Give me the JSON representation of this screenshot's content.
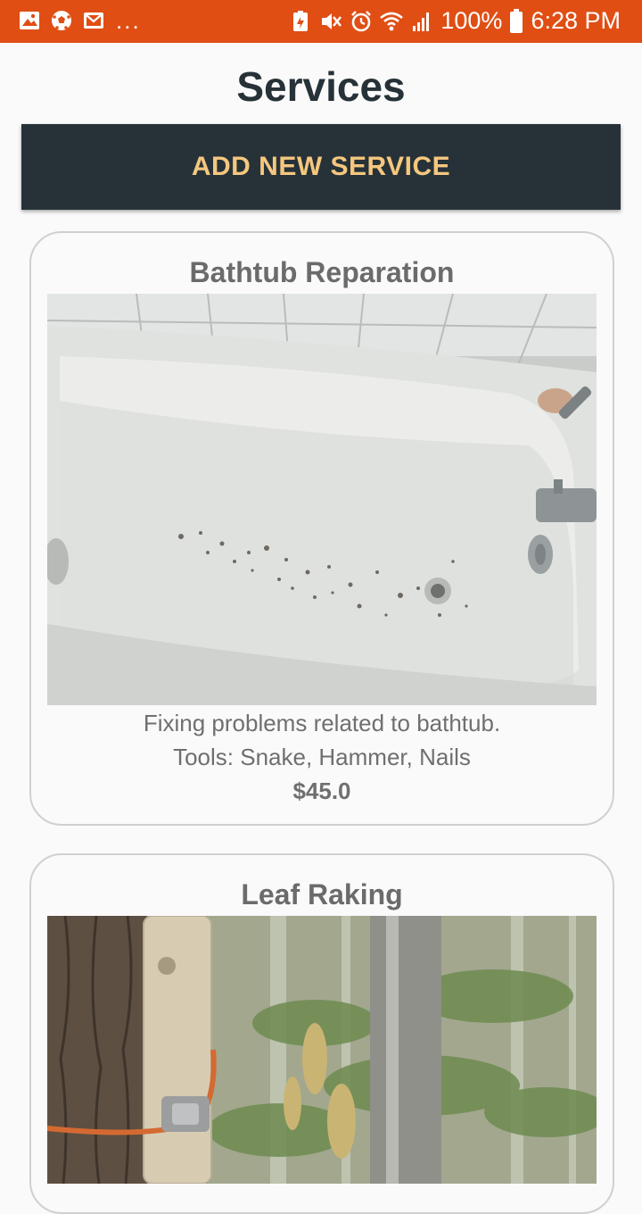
{
  "status_bar": {
    "battery": "100%",
    "time": "6:28 PM",
    "overflow": "...",
    "icons": [
      "image-icon",
      "soccer-ball-icon",
      "mail-icon",
      "battery-saver-icon",
      "mute-icon",
      "alarm-icon",
      "wifi-icon",
      "signal-icon",
      "battery-icon"
    ]
  },
  "page": {
    "title": "Services",
    "add_button": "ADD NEW SERVICE"
  },
  "services": [
    {
      "title": "Bathtub Reparation",
      "description": "Fixing problems related to bathtub.",
      "tools": "Tools: Snake, Hammer, Nails",
      "price": "$45.0"
    },
    {
      "title": "Leaf Raking"
    }
  ],
  "colors": {
    "status_bar": "#e04e14",
    "button_bg": "#263238",
    "button_text": "#f5c77e",
    "title": "#263238"
  }
}
